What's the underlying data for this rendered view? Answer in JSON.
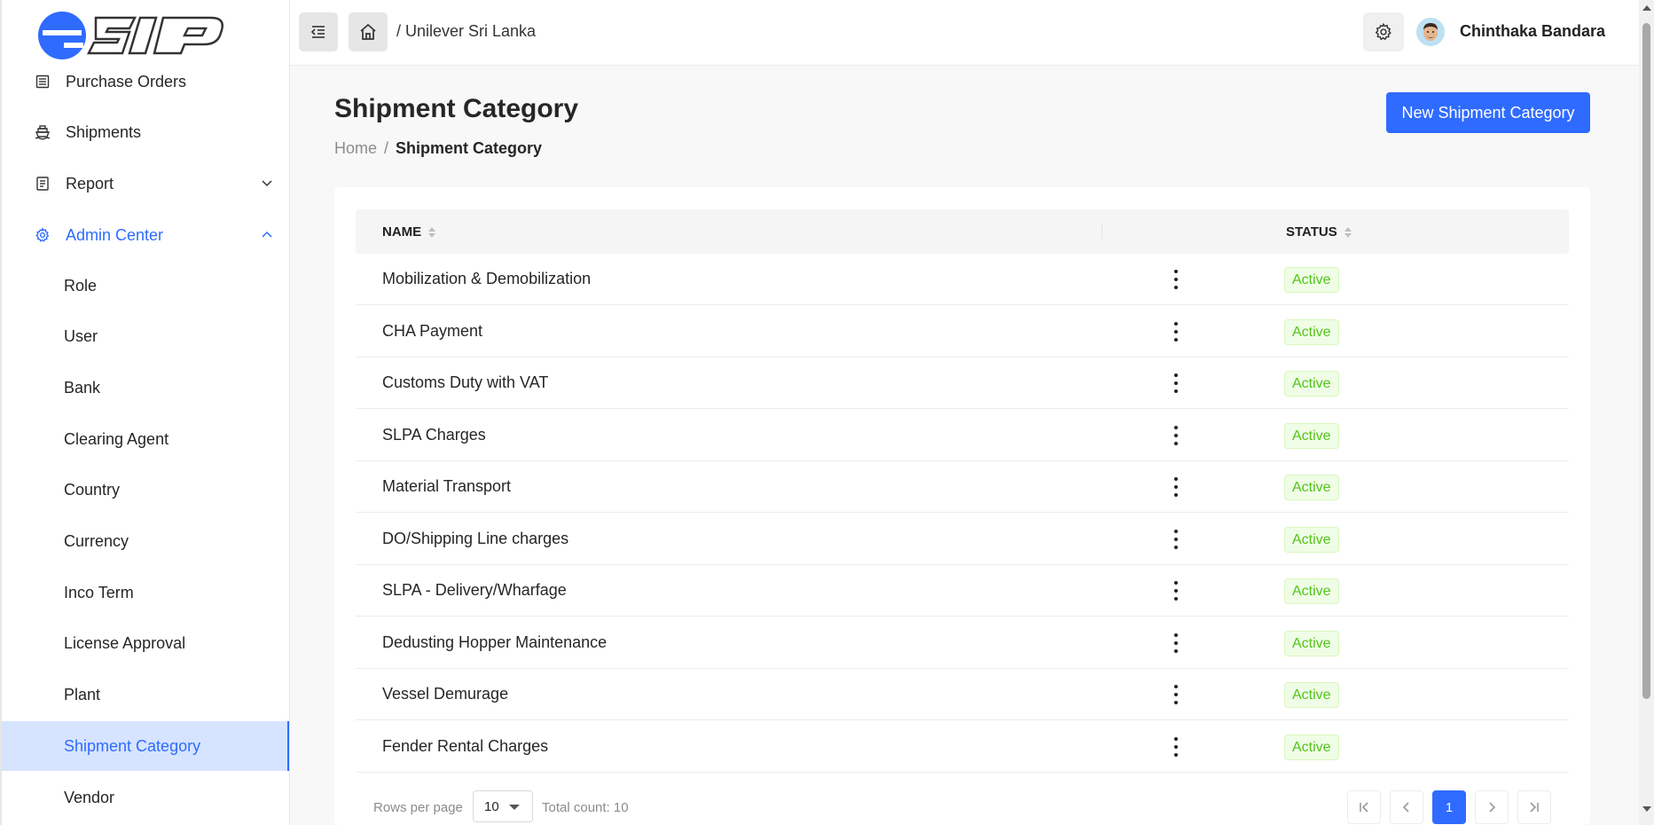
{
  "brand": {
    "logo_text": "eSIP",
    "accent": "#2f6bff"
  },
  "sidebar": {
    "items": [
      {
        "label": "Purchase Orders",
        "icon": "list-icon"
      },
      {
        "label": "Shipments",
        "icon": "ship-icon"
      },
      {
        "label": "Report",
        "icon": "report-icon",
        "chevron": "down"
      },
      {
        "label": "Admin Center",
        "icon": "gear-icon",
        "chevron": "up"
      }
    ],
    "sub_items": [
      {
        "label": "Role"
      },
      {
        "label": "User"
      },
      {
        "label": "Bank"
      },
      {
        "label": "Clearing Agent"
      },
      {
        "label": "Country"
      },
      {
        "label": "Currency"
      },
      {
        "label": "Inco Term"
      },
      {
        "label": "License Approval"
      },
      {
        "label": "Plant"
      },
      {
        "label": "Shipment Category"
      },
      {
        "label": "Vendor"
      }
    ]
  },
  "header": {
    "company_crumb": "/ Unilever Sri Lanka",
    "user_name": "Chinthaka Bandara"
  },
  "main": {
    "title": "Shipment Category",
    "breadcrumb": {
      "home": "Home",
      "sep": "/",
      "current": "Shipment Category"
    },
    "new_button": "New Shipment Category"
  },
  "table": {
    "columns": {
      "name": "NAME",
      "status": "STATUS"
    },
    "rows": [
      {
        "name": "Mobilization & Demobilization",
        "status": "Active"
      },
      {
        "name": "CHA Payment",
        "status": "Active"
      },
      {
        "name": "Customs Duty with VAT",
        "status": "Active"
      },
      {
        "name": "SLPA Charges",
        "status": "Active"
      },
      {
        "name": "Material Transport",
        "status": "Active"
      },
      {
        "name": "DO/Shipping Line charges",
        "status": "Active"
      },
      {
        "name": "SLPA - Delivery/Wharfage",
        "status": "Active"
      },
      {
        "name": "Dedusting Hopper Maintenance",
        "status": "Active"
      },
      {
        "name": "Vessel Demurage",
        "status": "Active"
      },
      {
        "name": "Fender Rental Charges",
        "status": "Active"
      }
    ]
  },
  "pagination": {
    "rows_per_page_label": "Rows per page",
    "rows_per_page": "10",
    "total_label": "Total count: 10",
    "current_page": "1"
  }
}
